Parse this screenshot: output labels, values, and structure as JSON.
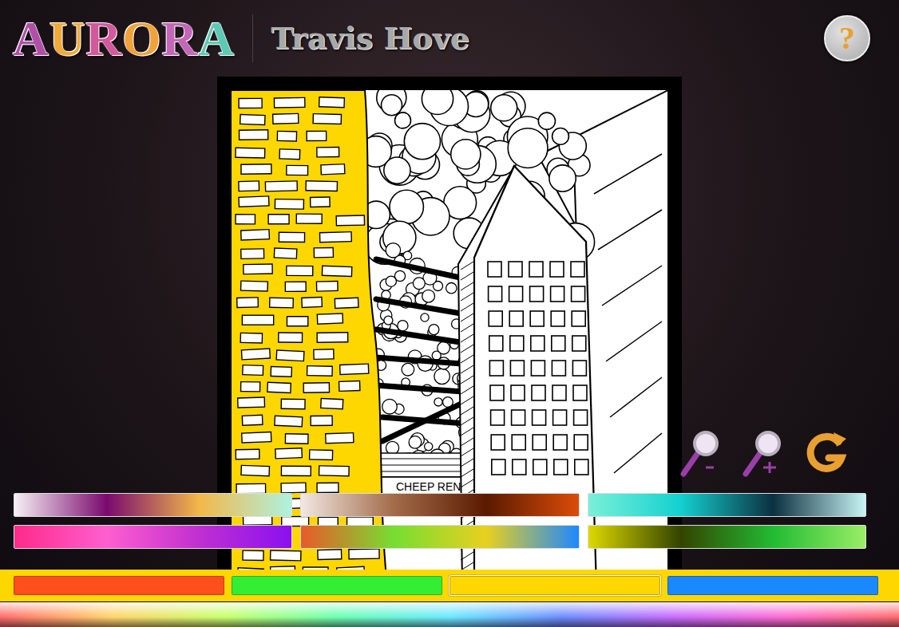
{
  "app": {
    "logo": [
      {
        "text": "A",
        "color": "#b04fa8"
      },
      {
        "text": "U",
        "color": "#f2a93b"
      },
      {
        "text": "R",
        "color": "#d4589c"
      },
      {
        "text": "O",
        "color": "#f2a23a"
      },
      {
        "text": "R",
        "color": "#c467b8"
      },
      {
        "text": "A",
        "color": "#5cc9b5"
      }
    ],
    "title": "Travis Hove",
    "help": "?"
  },
  "artwork": {
    "sign_text": "CHEEP RENT",
    "wall_color": "#ffd700"
  },
  "gradients": [
    {
      "colors": [
        "#f6f0f4",
        "#7a0a6e",
        "#f2b848",
        "#aef2e0"
      ]
    },
    {
      "colors": [
        "#f2e8e2",
        "#a36c4a",
        "#5a1a00",
        "#dc4c0a"
      ]
    },
    {
      "colors": [
        "#7af0d8",
        "#14d0d0",
        "#0b3040",
        "#c8f4f4"
      ]
    },
    {
      "colors": [
        "#ff2a8a",
        "#ff5ed0",
        "#c030d0",
        "#8a10f0"
      ]
    },
    {
      "colors": [
        "#e85a2a",
        "#77dd33",
        "#e8d020",
        "#1e88ff"
      ]
    },
    {
      "colors": [
        "#ddd800",
        "#334400",
        "#22bb33",
        "#99ee66"
      ]
    }
  ],
  "swatches": [
    {
      "color": "#ff4f1a",
      "selected": false
    },
    {
      "color": "#33ee33",
      "selected": false
    },
    {
      "color": "#ffd700",
      "selected": true
    },
    {
      "color": "#1a88ff",
      "selected": false
    }
  ]
}
